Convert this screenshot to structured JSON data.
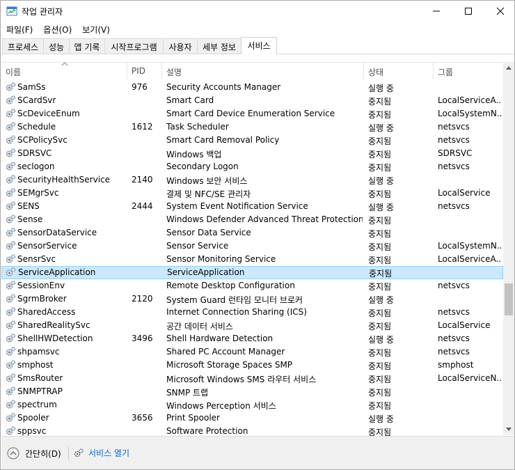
{
  "window": {
    "title": "작업 관리자"
  },
  "menu": [
    "파일(F)",
    "옵션(O)",
    "보기(V)"
  ],
  "tabs": [
    {
      "label": "프로세스",
      "active": false
    },
    {
      "label": "성능",
      "active": false
    },
    {
      "label": "앱 기록",
      "active": false
    },
    {
      "label": "시작프로그램",
      "active": false
    },
    {
      "label": "사용자",
      "active": false
    },
    {
      "label": "세부 정보",
      "active": false
    },
    {
      "label": "서비스",
      "active": true
    }
  ],
  "columns": [
    "이름",
    "PID",
    "설명",
    "상태",
    "그룹"
  ],
  "services": [
    {
      "name": "SamSs",
      "pid": "976",
      "desc": "Security Accounts Manager",
      "status": "실행 중",
      "group": ""
    },
    {
      "name": "SCardSvr",
      "pid": "",
      "desc": "Smart Card",
      "status": "중지됨",
      "group": "LocalServiceA..."
    },
    {
      "name": "ScDeviceEnum",
      "pid": "",
      "desc": "Smart Card Device Enumeration Service",
      "status": "중지됨",
      "group": "LocalSystemN..."
    },
    {
      "name": "Schedule",
      "pid": "1612",
      "desc": "Task Scheduler",
      "status": "실행 중",
      "group": "netsvcs"
    },
    {
      "name": "SCPolicySvc",
      "pid": "",
      "desc": "Smart Card Removal Policy",
      "status": "중지됨",
      "group": "netsvcs"
    },
    {
      "name": "SDRSVC",
      "pid": "",
      "desc": "Windows 백업",
      "status": "중지됨",
      "group": "SDRSVC"
    },
    {
      "name": "seclogon",
      "pid": "",
      "desc": "Secondary Logon",
      "status": "중지됨",
      "group": "netsvcs"
    },
    {
      "name": "SecurityHealthService",
      "pid": "2140",
      "desc": "Windows 보안 서비스",
      "status": "실행 중",
      "group": ""
    },
    {
      "name": "SEMgrSvc",
      "pid": "",
      "desc": "결제 및 NFC/SE 관리자",
      "status": "중지됨",
      "group": "LocalService"
    },
    {
      "name": "SENS",
      "pid": "2444",
      "desc": "System Event Notification Service",
      "status": "실행 중",
      "group": "netsvcs"
    },
    {
      "name": "Sense",
      "pid": "",
      "desc": "Windows Defender Advanced Threat Protection S...",
      "status": "중지됨",
      "group": ""
    },
    {
      "name": "SensorDataService",
      "pid": "",
      "desc": "Sensor Data Service",
      "status": "중지됨",
      "group": ""
    },
    {
      "name": "SensorService",
      "pid": "",
      "desc": "Sensor Service",
      "status": "중지됨",
      "group": "LocalSystemN..."
    },
    {
      "name": "SensrSvc",
      "pid": "",
      "desc": "Sensor Monitoring Service",
      "status": "중지됨",
      "group": "LocalServiceA..."
    },
    {
      "name": "ServiceApplication",
      "pid": "",
      "desc": "ServiceApplication",
      "status": "중지됨",
      "group": "",
      "selected": true
    },
    {
      "name": "SessionEnv",
      "pid": "",
      "desc": "Remote Desktop Configuration",
      "status": "중지됨",
      "group": "netsvcs"
    },
    {
      "name": "SgrmBroker",
      "pid": "2120",
      "desc": "System Guard 런타임 모니터 브로커",
      "status": "실행 중",
      "group": ""
    },
    {
      "name": "SharedAccess",
      "pid": "",
      "desc": "Internet Connection Sharing (ICS)",
      "status": "중지됨",
      "group": "netsvcs"
    },
    {
      "name": "SharedRealitySvc",
      "pid": "",
      "desc": "공간 데이터 서비스",
      "status": "중지됨",
      "group": "LocalService"
    },
    {
      "name": "ShellHWDetection",
      "pid": "3496",
      "desc": "Shell Hardware Detection",
      "status": "실행 중",
      "group": "netsvcs"
    },
    {
      "name": "shpamsvc",
      "pid": "",
      "desc": "Shared PC Account Manager",
      "status": "중지됨",
      "group": "netsvcs"
    },
    {
      "name": "smphost",
      "pid": "",
      "desc": "Microsoft Storage Spaces SMP",
      "status": "중지됨",
      "group": "smphost"
    },
    {
      "name": "SmsRouter",
      "pid": "",
      "desc": "Microsoft Windows SMS 라우터 서비스",
      "status": "중지됨",
      "group": "LocalServiceN..."
    },
    {
      "name": "SNMPTRAP",
      "pid": "",
      "desc": "SNMP 트랩",
      "status": "중지됨",
      "group": ""
    },
    {
      "name": "spectrum",
      "pid": "",
      "desc": "Windows Perception 서비스",
      "status": "중지됨",
      "group": ""
    },
    {
      "name": "Spooler",
      "pid": "3656",
      "desc": "Print Spooler",
      "status": "실행 중",
      "group": ""
    },
    {
      "name": "sppsvc",
      "pid": "",
      "desc": "Software Protection",
      "status": "중지됨",
      "group": ""
    }
  ],
  "footer": {
    "less_details": "간단히(D)",
    "open_services": "서비스 열기"
  }
}
